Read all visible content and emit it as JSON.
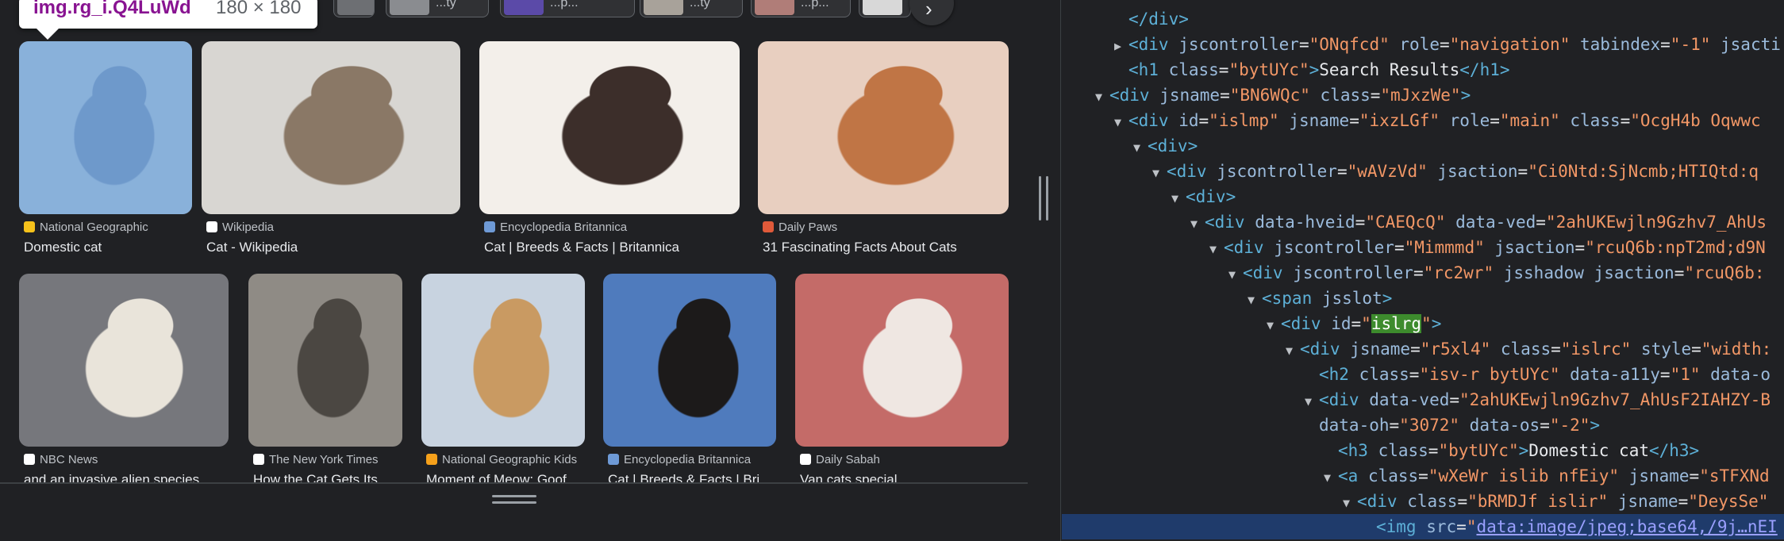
{
  "tooltip": {
    "selector": "img.rg_i.Q4LuWd",
    "dimensions": "180 × 180"
  },
  "chips": [
    {
      "thumb_color": "#6d6f73",
      "label": ""
    },
    {
      "thumb_color": "#8a8c90",
      "label": "...ty"
    },
    {
      "thumb_color": "#5b4aa8",
      "label": "...p..."
    },
    {
      "thumb_color": "#a8a29a",
      "label": "...ty"
    },
    {
      "thumb_color": "#b07d78",
      "label": "...p..."
    },
    {
      "thumb_color": "#d8d8d8",
      "label": ""
    }
  ],
  "results": [
    {
      "source": "National Geographic",
      "title": "Domestic cat",
      "fav_color": "#f6c21b",
      "img_colors": [
        "#a9bcd8",
        "#6d87b5"
      ]
    },
    {
      "source": "Wikipedia",
      "title": "Cat - Wikipedia",
      "fav_color": "#ffffff",
      "img_colors": [
        "#d8d6d2",
        "#8a7866"
      ]
    },
    {
      "source": "Encyclopedia Britannica",
      "title": "Cat | Breeds & Facts | Britannica",
      "fav_color": "#6e9ad6",
      "img_colors": [
        "#f3efea",
        "#3c2e2a"
      ]
    },
    {
      "source": "Daily Paws",
      "title": "31 Fascinating Facts About Cats",
      "fav_color": "#e05a3a",
      "img_colors": [
        "#e8cfc0",
        "#c07545"
      ]
    },
    {
      "source": "NBC News",
      "title": "and an invasive alien species",
      "fav_color": "#ffffff",
      "img_colors": [
        "#76777c",
        "#e9e4da"
      ]
    },
    {
      "source": "The New York Times",
      "title": "How the Cat Gets Its ...",
      "fav_color": "#ffffff",
      "img_colors": [
        "#8f8b85",
        "#4b4742"
      ]
    },
    {
      "source": "National Geographic Kids",
      "title": "Moment of Meow: Goof...",
      "fav_color": "#f6a11b",
      "img_colors": [
        "#c8d3e0",
        "#c99a62"
      ]
    },
    {
      "source": "Encyclopedia Britannica",
      "title": "Cat | Breeds & Facts | Bri...",
      "fav_color": "#6e9ad6",
      "img_colors": [
        "#4f7bbd",
        "#1c1a1a"
      ]
    },
    {
      "source": "Daily Sabah",
      "title": "Van cats special ...",
      "fav_color": "#ffffff",
      "img_colors": [
        "#c46b68",
        "#efe7e2"
      ]
    }
  ],
  "devtools": {
    "lines": [
      {
        "indent": 2,
        "tri": "",
        "parts": [
          [
            "tag",
            "</div>"
          ]
        ]
      },
      {
        "indent": 2,
        "tri": "▶",
        "parts": [
          [
            "tag",
            "<div "
          ],
          [
            "an",
            "jscontroller"
          ],
          [
            "txt",
            "="
          ],
          [
            "av",
            "\"ONqfcd\""
          ],
          [
            "an",
            " role"
          ],
          [
            "txt",
            "="
          ],
          [
            "av",
            "\"navigation\""
          ],
          [
            "an",
            " tabindex"
          ],
          [
            "txt",
            "="
          ],
          [
            "av",
            "\"-1\""
          ],
          [
            "an",
            " jsacti"
          ]
        ]
      },
      {
        "indent": 2,
        "tri": "",
        "parts": [
          [
            "tag",
            "<h1 "
          ],
          [
            "an",
            "class"
          ],
          [
            "txt",
            "="
          ],
          [
            "av",
            "\"bytUYc\""
          ],
          [
            "tag",
            ">"
          ],
          [
            "txt",
            "Search Results"
          ],
          [
            "tag",
            "</h1>"
          ]
        ]
      },
      {
        "indent": 1,
        "tri": "▼",
        "parts": [
          [
            "tag",
            "<div "
          ],
          [
            "an",
            "jsname"
          ],
          [
            "txt",
            "="
          ],
          [
            "av",
            "\"BN6WQc\""
          ],
          [
            "an",
            " class"
          ],
          [
            "txt",
            "="
          ],
          [
            "av",
            "\"mJxzWe\""
          ],
          [
            "tag",
            ">"
          ]
        ]
      },
      {
        "indent": 2,
        "tri": "▼",
        "parts": [
          [
            "tag",
            "<div "
          ],
          [
            "an",
            "id"
          ],
          [
            "txt",
            "="
          ],
          [
            "av",
            "\"islmp\""
          ],
          [
            "an",
            " jsname"
          ],
          [
            "txt",
            "="
          ],
          [
            "av",
            "\"ixzLGf\""
          ],
          [
            "an",
            " role"
          ],
          [
            "txt",
            "="
          ],
          [
            "av",
            "\"main\""
          ],
          [
            "an",
            " class"
          ],
          [
            "txt",
            "="
          ],
          [
            "av",
            "\"OcgH4b Oqwwc"
          ]
        ]
      },
      {
        "indent": 3,
        "tri": "▼",
        "parts": [
          [
            "tag",
            "<div>"
          ]
        ]
      },
      {
        "indent": 4,
        "tri": "▼",
        "parts": [
          [
            "tag",
            "<div "
          ],
          [
            "an",
            "jscontroller"
          ],
          [
            "txt",
            "="
          ],
          [
            "av",
            "\"wAVzVd\""
          ],
          [
            "an",
            " jsaction"
          ],
          [
            "txt",
            "="
          ],
          [
            "av",
            "\"Ci0Ntd:SjNcmb;HTIQtd:q"
          ]
        ]
      },
      {
        "indent": 5,
        "tri": "▼",
        "parts": [
          [
            "tag",
            "<div>"
          ]
        ]
      },
      {
        "indent": 6,
        "tri": "▼",
        "parts": [
          [
            "tag",
            "<div "
          ],
          [
            "an",
            "data-hveid"
          ],
          [
            "txt",
            "="
          ],
          [
            "av",
            "\"CAEQcQ\""
          ],
          [
            "an",
            " data-ved"
          ],
          [
            "txt",
            "="
          ],
          [
            "av",
            "\"2ahUKEwjln9Gzhv7_AhUs"
          ]
        ]
      },
      {
        "indent": 7,
        "tri": "▼",
        "parts": [
          [
            "tag",
            "<div "
          ],
          [
            "an",
            "jscontroller"
          ],
          [
            "txt",
            "="
          ],
          [
            "av",
            "\"Mimmmd\""
          ],
          [
            "an",
            " jsaction"
          ],
          [
            "txt",
            "="
          ],
          [
            "av",
            "\"rcuQ6b:npT2md;d9N"
          ]
        ]
      },
      {
        "indent": 8,
        "tri": "▼",
        "parts": [
          [
            "tag",
            "<div "
          ],
          [
            "an",
            "jscontroller"
          ],
          [
            "txt",
            "="
          ],
          [
            "av",
            "\"rc2wr\""
          ],
          [
            "an",
            " jsshadow"
          ],
          [
            "an",
            " jsaction"
          ],
          [
            "txt",
            "="
          ],
          [
            "av",
            "\"rcuQ6b:"
          ]
        ]
      },
      {
        "indent": 9,
        "tri": "▼",
        "parts": [
          [
            "tag",
            "<span "
          ],
          [
            "an",
            "jsslot"
          ],
          [
            "tag",
            ">"
          ]
        ]
      },
      {
        "indent": 10,
        "tri": "▼",
        "parts": [
          [
            "tag",
            "<div "
          ],
          [
            "an",
            "id"
          ],
          [
            "txt",
            "="
          ],
          [
            "av",
            "\""
          ],
          [
            "hl",
            "islrg"
          ],
          [
            "av",
            "\""
          ],
          [
            "tag",
            ">"
          ]
        ]
      },
      {
        "indent": 11,
        "tri": "▼",
        "parts": [
          [
            "tag",
            "<div "
          ],
          [
            "an",
            "jsname"
          ],
          [
            "txt",
            "="
          ],
          [
            "av",
            "\"r5xl4\""
          ],
          [
            "an",
            " class"
          ],
          [
            "txt",
            "="
          ],
          [
            "av",
            "\"islrc\""
          ],
          [
            "an",
            " style"
          ],
          [
            "txt",
            "="
          ],
          [
            "av",
            "\"width:"
          ]
        ]
      },
      {
        "indent": 12,
        "tri": "",
        "parts": [
          [
            "tag",
            "<h2 "
          ],
          [
            "an",
            "class"
          ],
          [
            "txt",
            "="
          ],
          [
            "av",
            "\"isv-r bytUYc\""
          ],
          [
            "an",
            " data-a11y"
          ],
          [
            "txt",
            "="
          ],
          [
            "av",
            "\"1\""
          ],
          [
            "an",
            " data-o"
          ]
        ]
      },
      {
        "indent": 12,
        "tri": "▼",
        "parts": [
          [
            "tag",
            "<div "
          ],
          [
            "an",
            "data-ved"
          ],
          [
            "txt",
            "="
          ],
          [
            "av",
            "\"2ahUKEwjln9Gzhv7_AhUsF2IAHZY-B"
          ]
        ]
      },
      {
        "indent": 12,
        "tri": "",
        "parts": [
          [
            "an",
            "data-oh"
          ],
          [
            "txt",
            "="
          ],
          [
            "av",
            "\"3072\""
          ],
          [
            "an",
            " data-os"
          ],
          [
            "txt",
            "="
          ],
          [
            "av",
            "\"-2\""
          ],
          [
            "tag",
            ">"
          ]
        ]
      },
      {
        "indent": 13,
        "tri": "",
        "parts": [
          [
            "tag",
            "<h3 "
          ],
          [
            "an",
            "class"
          ],
          [
            "txt",
            "="
          ],
          [
            "av",
            "\"bytUYc\""
          ],
          [
            "tag",
            ">"
          ],
          [
            "txt",
            "Domestic cat"
          ],
          [
            "tag",
            "</h3>"
          ]
        ]
      },
      {
        "indent": 13,
        "tri": "▼",
        "parts": [
          [
            "tag",
            "<a "
          ],
          [
            "an",
            "class"
          ],
          [
            "txt",
            "="
          ],
          [
            "av",
            "\"wXeWr islib nfEiy\""
          ],
          [
            "an",
            " jsname"
          ],
          [
            "txt",
            "="
          ],
          [
            "av",
            "\"sTFXNd"
          ]
        ]
      },
      {
        "indent": 14,
        "tri": "▼",
        "parts": [
          [
            "tag",
            "<div "
          ],
          [
            "an",
            "class"
          ],
          [
            "txt",
            "="
          ],
          [
            "av",
            "\"bRMDJf islir\""
          ],
          [
            "an",
            " jsname"
          ],
          [
            "txt",
            "="
          ],
          [
            "av",
            "\"DeysSe\""
          ]
        ]
      },
      {
        "indent": 15,
        "tri": "",
        "parts": [
          [
            "tag",
            "<img "
          ],
          [
            "an",
            "src"
          ],
          [
            "txt",
            "="
          ],
          [
            "av",
            "\""
          ],
          [
            "link",
            "data:image/jpeg;base64,/9j…nEI"
          ]
        ]
      }
    ]
  }
}
